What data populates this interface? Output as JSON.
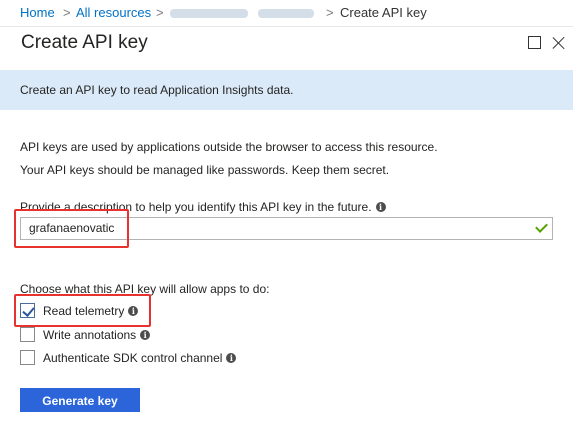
{
  "breadcrumb": {
    "home": "Home",
    "all_resources": "All resources",
    "current": "Create API key",
    "separator": ">"
  },
  "panel": {
    "title": "Create API key"
  },
  "banner": {
    "text": "Create an API key to read Application Insights data."
  },
  "intro": {
    "line1": "API keys are used by applications outside the browser to access this resource.",
    "line2": "Your API keys should be managed like passwords. Keep them secret."
  },
  "description": {
    "label": "Provide a description to help you identify this API key in the future.",
    "value": "grafanaenovatic"
  },
  "permissions": {
    "label": "Choose what this API key will allow apps to do:",
    "options": [
      {
        "label": "Read telemetry",
        "checked": true
      },
      {
        "label": "Write annotations",
        "checked": false
      },
      {
        "label": "Authenticate SDK control channel",
        "checked": false
      }
    ]
  },
  "actions": {
    "generate_label": "Generate key"
  },
  "colors": {
    "link": "#0072c6",
    "banner": "#dbeaf8",
    "primary_button": "#2b65d9",
    "highlight": "#e8322f",
    "valid_check": "#57a300"
  }
}
